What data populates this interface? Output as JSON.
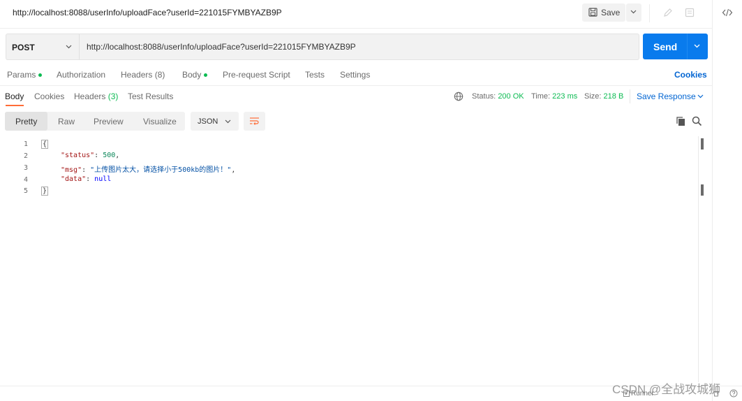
{
  "titlebar": {
    "url": "http://localhost:8088/userInfo/uploadFace?userId=221015FYMBYAZB9P",
    "save_label": "Save"
  },
  "request": {
    "method": "POST",
    "url": "http://localhost:8088/userInfo/uploadFace?userId=221015FYMBYAZB9P",
    "send_label": "Send"
  },
  "request_tabs": {
    "params": "Params",
    "authorization": "Authorization",
    "headers": "Headers (8)",
    "body": "Body",
    "pre_request": "Pre-request Script",
    "tests": "Tests",
    "settings": "Settings",
    "cookies": "Cookies"
  },
  "response_tabs": {
    "body": "Body",
    "cookies": "Cookies",
    "headers": "Headers",
    "headers_count": "(3)",
    "test_results": "Test Results"
  },
  "status": {
    "status_label": "Status:",
    "status_value": "200 OK",
    "time_label": "Time:",
    "time_value": "223 ms",
    "size_label": "Size:",
    "size_value": "218 B",
    "save_response": "Save Response"
  },
  "view": {
    "pretty": "Pretty",
    "raw": "Raw",
    "preview": "Preview",
    "visualize": "Visualize",
    "format": "JSON"
  },
  "code": {
    "line_numbers": [
      "1",
      "2",
      "3",
      "4",
      "5"
    ],
    "open_brace": "{",
    "close_brace": "}",
    "status_key": "\"status\"",
    "status_value": "500",
    "msg_key": "\"msg\"",
    "msg_value": "\"上传图片太大，请选择小于500kb的图片！\"",
    "data_key": "\"data\"",
    "data_value": "null"
  },
  "footer": {
    "runner": "Runner",
    "watermark": "CSDN @全战攻城狮"
  },
  "colors": {
    "accent": "#097bed",
    "success": "#0cbb52",
    "tab_underline": "#ff6c37",
    "link": "#0265d2"
  }
}
